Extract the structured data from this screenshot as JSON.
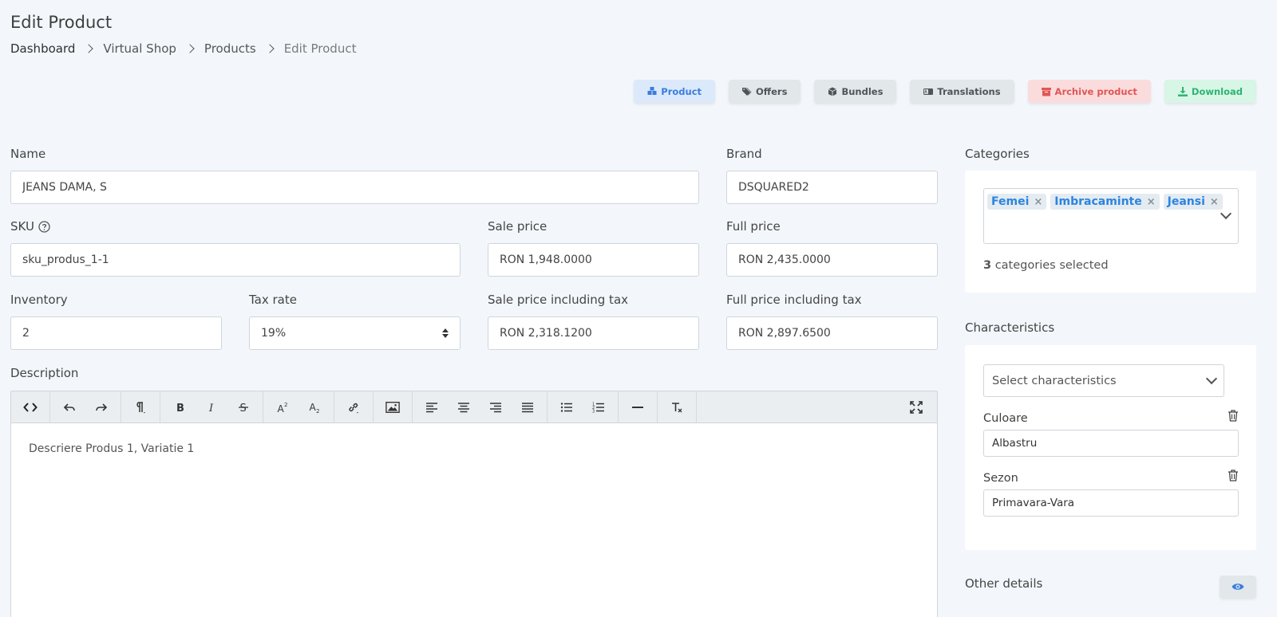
{
  "page": {
    "title": "Edit Product",
    "breadcrumb": [
      "Dashboard",
      "Virtual Shop",
      "Products",
      "Edit Product"
    ]
  },
  "actions": {
    "product": "Product",
    "offers": "Offers",
    "bundles": "Bundles",
    "translations": "Translations",
    "archive": "Archive product",
    "download": "Download"
  },
  "colors": {
    "accent": "#3b7ddd",
    "danger": "#e05656",
    "success": "#2fb374",
    "tag_text": "#2b84e0"
  },
  "form": {
    "name_label": "Name",
    "name_value": "JEANS DAMA, S",
    "brand_label": "Brand",
    "brand_value": "DSQUARED2",
    "sku_label": "SKU",
    "sku_value": "sku_produs_1-1",
    "sale_price_label": "Sale price",
    "sale_price_value": "RON 1,948.0000",
    "full_price_label": "Full price",
    "full_price_value": "RON 2,435.0000",
    "inventory_label": "Inventory",
    "inventory_value": "2",
    "tax_rate_label": "Tax rate",
    "tax_rate_value": "19%",
    "sale_price_tax_label": "Sale price including tax",
    "sale_price_tax_value": "RON 2,318.1200",
    "full_price_tax_label": "Full price including tax",
    "full_price_tax_value": "RON 2,897.6500",
    "description_label": "Description",
    "description_value": "Descriere Produs 1, Variatie 1"
  },
  "categories": {
    "title": "Categories",
    "tags": [
      "Femei",
      "Imbracaminte",
      "Jeansi"
    ],
    "tag_remove": "×",
    "count": "3",
    "count_suffix": "categories selected"
  },
  "characteristics": {
    "title": "Characteristics",
    "select_placeholder": "Select characteristics",
    "items": [
      {
        "label": "Culoare",
        "value": "Albastru"
      },
      {
        "label": "Sezon",
        "value": "Primavara-Vara"
      }
    ]
  },
  "other_details": {
    "title": "Other details"
  }
}
